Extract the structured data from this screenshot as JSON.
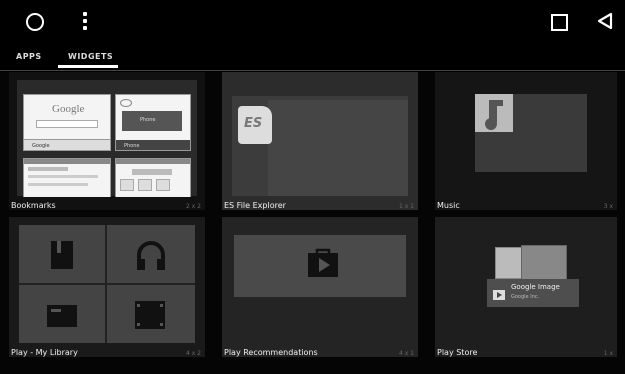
{
  "tabs": [
    {
      "label": "APPS"
    },
    {
      "label": "WIDGETS"
    }
  ],
  "widgets": [
    {
      "label": "Bookmarks",
      "dims": "2 x 2"
    },
    {
      "label": "ES File Explorer",
      "dims": "1 x 1"
    },
    {
      "label": "Music",
      "dims": "3 x"
    },
    {
      "label": "Play - My Library",
      "dims": "4 x 2"
    },
    {
      "label": "Play Recommendations",
      "dims": "4 x 1"
    },
    {
      "label": "Play Store",
      "dims": "1 x"
    }
  ],
  "thumb": {
    "google_text": "Google",
    "google_tab": "Google",
    "phone_tab": "Phone",
    "phone_btn": "Phone",
    "es_logo": "ES",
    "image_title": "Google Image",
    "image_sub": "Google Inc."
  }
}
